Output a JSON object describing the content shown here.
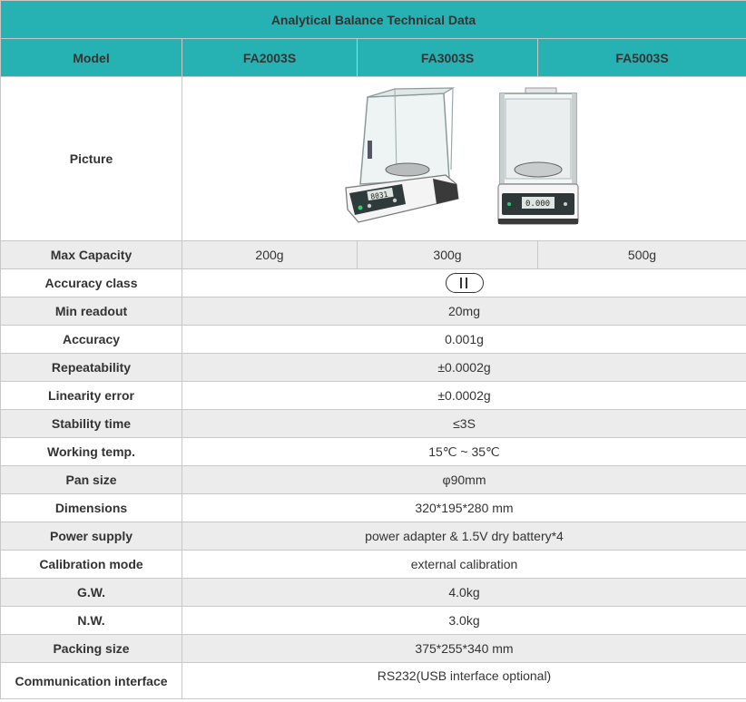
{
  "title": "Analytical Balance Technical Data",
  "header": {
    "model_label": "Model",
    "models": [
      "FA2003S",
      "FA3003S",
      "FA5003S"
    ]
  },
  "picture_label": "Picture",
  "rows": {
    "max_capacity": {
      "label": "Max Capacity",
      "values": [
        "200g",
        "300g",
        "500g"
      ]
    },
    "accuracy_class": {
      "label": "Accuracy class",
      "icon": "class-II-icon"
    },
    "min_readout": {
      "label": "Min readout",
      "value": "20mg"
    },
    "accuracy": {
      "label": "Accuracy",
      "value": "0.001g"
    },
    "repeatability": {
      "label": "Repeatability",
      "value": "±0.0002g"
    },
    "linearity": {
      "label": "Linearity error",
      "value": "±0.0002g"
    },
    "stability": {
      "label": "Stability time",
      "value": "≤3S"
    },
    "working_temp": {
      "label": "Working temp.",
      "value": "15℃ ~ 35℃"
    },
    "pan_size": {
      "label": "Pan size",
      "value": "φ90mm"
    },
    "dimensions": {
      "label": "Dimensions",
      "value": "320*195*280 mm"
    },
    "power": {
      "label": "Power supply",
      "value": "power adapter & 1.5V dry battery*4"
    },
    "calibration": {
      "label": "Calibration mode",
      "value": "external calibration"
    },
    "gw": {
      "label": "G.W.",
      "value": "4.0kg"
    },
    "nw": {
      "label": "N.W.",
      "value": "3.0kg"
    },
    "packing": {
      "label": "Packing size",
      "value": "375*255*340 mm"
    },
    "comm": {
      "label": "Communication interface",
      "value": "RS232(USB interface optional)"
    }
  },
  "colors": {
    "accent": "#26b2b3",
    "stripe": "#ececec"
  }
}
